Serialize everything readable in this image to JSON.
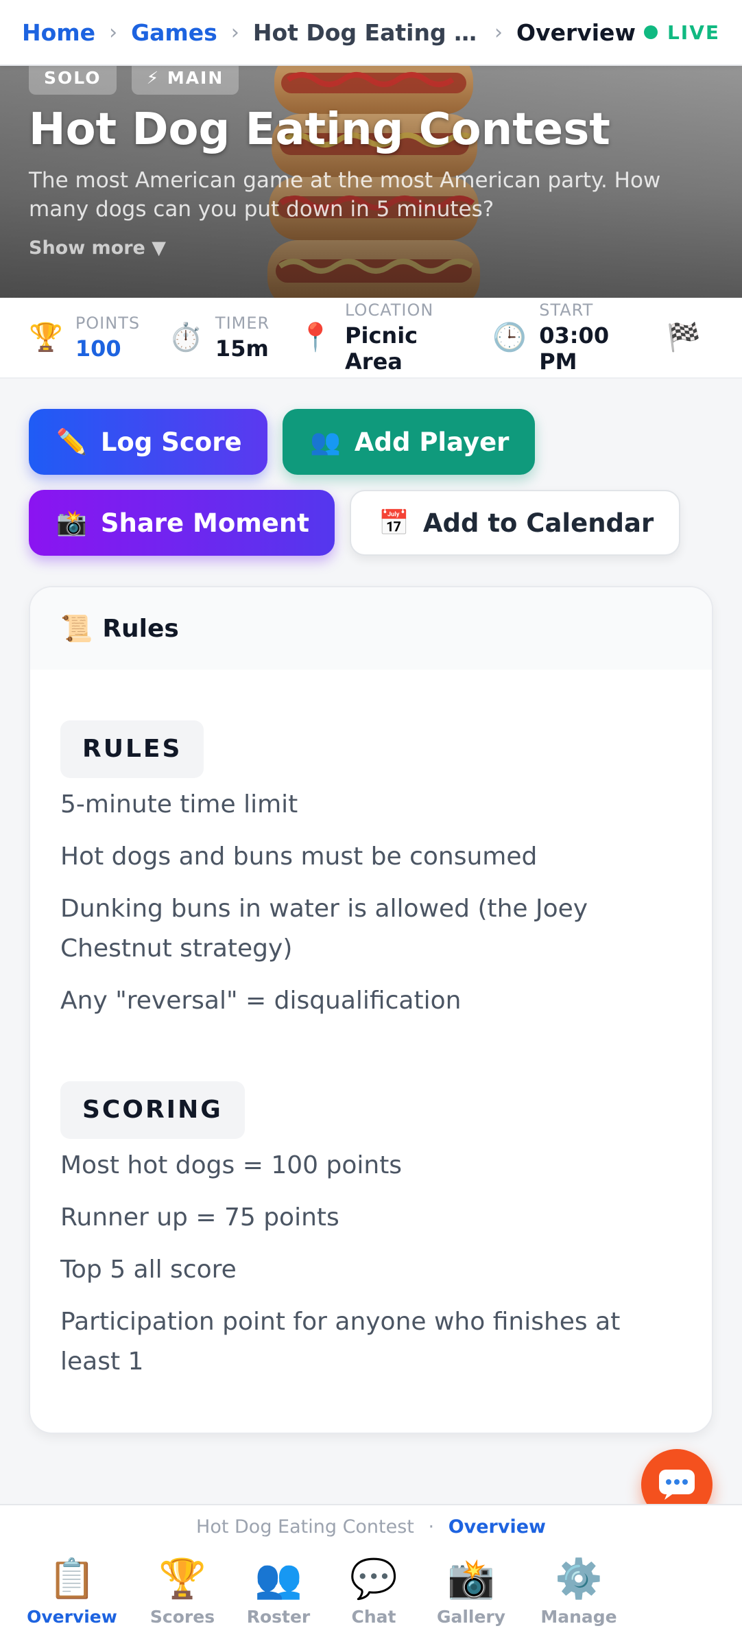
{
  "breadcrumb": {
    "home": "Home",
    "games": "Games",
    "game": "Hot Dog Eating Co...",
    "page": "Overview",
    "status": "LIVE"
  },
  "hero": {
    "tags": [
      "SOLO",
      "⚡ MAIN"
    ],
    "title": "Hot Dog Eating Contest",
    "description": "The most American game at the most American party. How many dogs can you put down in 5 minutes?",
    "show_more": "Show more ▼"
  },
  "stats": [
    {
      "icon": "trophy-icon",
      "glyph": "🏆",
      "label": "POINTS",
      "value": "100"
    },
    {
      "icon": "stopwatch-icon",
      "glyph": "⏱️",
      "label": "TIMER",
      "value": "15m"
    },
    {
      "icon": "location-pin-icon",
      "glyph": "📍",
      "label": "LOCATION",
      "value": "Picnic Area"
    },
    {
      "icon": "clock-icon",
      "glyph": "🕒",
      "label": "START",
      "value": "03:00 PM"
    },
    {
      "icon": "checkered-flag-icon",
      "glyph": "🏁",
      "label": "",
      "value": ""
    }
  ],
  "actions": {
    "log_score": {
      "icon": "✏️",
      "label": "Log Score"
    },
    "add_player": {
      "icon": "👥",
      "label": "Add Player"
    },
    "share_moment": {
      "icon": "📸",
      "label": "Share Moment"
    },
    "add_calendar": {
      "icon": "📅",
      "label": "Add to Calendar"
    }
  },
  "rules_card": {
    "icon": "📜",
    "title": "Rules",
    "rules_heading": "RULES",
    "rules": [
      "5-minute time limit",
      "Hot dogs and buns must be consumed",
      "Dunking buns in water is allowed (the Joey Chestnut strategy)",
      "Any \"reversal\" = disqualification"
    ],
    "scoring_heading": "SCORING",
    "scoring": [
      "Most hot dogs = 100 points",
      "Runner up = 75 points",
      "Top 5 all score",
      "Participation point for anyone who finishes at least 1"
    ]
  },
  "footer": {
    "game": "Hot Dog Eating Contest",
    "separator": "·",
    "page": "Overview"
  },
  "tabs": [
    {
      "icon": "clipboard-icon",
      "glyph": "📋",
      "label": "Overview",
      "active": true
    },
    {
      "icon": "trophy-icon",
      "glyph": "🏆",
      "label": "Scores",
      "active": false
    },
    {
      "icon": "people-icon",
      "glyph": "👥",
      "label": "Roster",
      "active": false
    },
    {
      "icon": "chat-bubble-icon",
      "glyph": "💬",
      "label": "Chat",
      "active": false
    },
    {
      "icon": "camera-icon",
      "glyph": "📸",
      "label": "Gallery",
      "active": false
    },
    {
      "icon": "gear-icon",
      "glyph": "⚙️",
      "label": "Manage",
      "active": false
    }
  ],
  "colors": {
    "accent": "#1d63e0",
    "live": "#10b981",
    "log_score": "#1f5cf5",
    "add_player": "#0f9a7c",
    "share_moment": "#8b14f1",
    "fab": "#f4511e"
  }
}
